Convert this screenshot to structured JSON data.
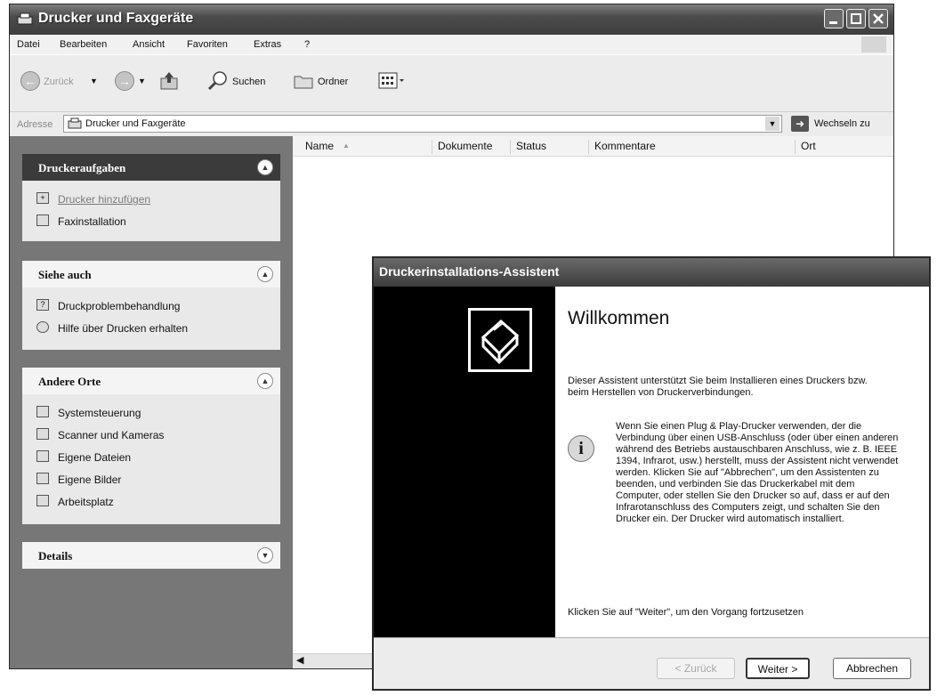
{
  "window": {
    "title": "Drucker und Faxgeräte"
  },
  "menubar": {
    "items": [
      "Datei",
      "Bearbeiten",
      "Ansicht",
      "Favoriten",
      "Extras",
      "?"
    ]
  },
  "toolbar": {
    "back_label": "Zurück",
    "search_label": "Suchen",
    "folders_label": "Ordner"
  },
  "address": {
    "label": "Adresse",
    "value": "Drucker und Faxgeräte",
    "go_label": "Wechseln zu"
  },
  "taskpane": {
    "printer_tasks": {
      "title": "Druckeraufgaben",
      "items": [
        "Drucker hinzufügen",
        "Faxinstallation"
      ]
    },
    "see_also": {
      "title": "Siehe auch",
      "items": [
        "Druckproblembehandlung",
        "Hilfe über Drucken erhalten"
      ]
    },
    "other_places": {
      "title": "Andere Orte",
      "items": [
        "Systemsteuerung",
        "Scanner und Kameras",
        "Eigene Dateien",
        "Eigene Bilder",
        "Arbeitsplatz"
      ]
    },
    "details": {
      "title": "Details"
    }
  },
  "listview": {
    "columns": [
      "Name",
      "Dokumente",
      "Status",
      "Kommentare",
      "Ort"
    ]
  },
  "wizard": {
    "title": "Druckerinstallations-Assistent",
    "heading": "Willkommen",
    "intro": "Dieser Assistent unterstützt Sie beim Installieren eines Druckers bzw. beim Herstellen von Druckerverbindungen.",
    "info": "Wenn Sie einen Plug & Play-Drucker verwenden, der die Verbindung über einen USB-Anschluss (oder über einen anderen während des Betriebs austauschbaren Anschluss, wie z. B. IEEE 1394, Infrarot, usw.) herstellt, muss der Assistent nicht verwendet werden. Klicken Sie auf \"Abbrechen\", um den Assistenten zu beenden, und verbinden Sie das Druckerkabel mit dem Computer, oder stellen Sie den Drucker so auf, dass er auf den Infrarotanschluss des Computers zeigt, und schalten Sie den Drucker ein. Der Drucker wird automatisch installiert.",
    "continue_text": "Klicken Sie auf \"Weiter\", um den Vorgang fortzusetzen",
    "back_button": "< Zurück",
    "next_button": "Weiter >",
    "cancel_button": "Abbrechen"
  }
}
